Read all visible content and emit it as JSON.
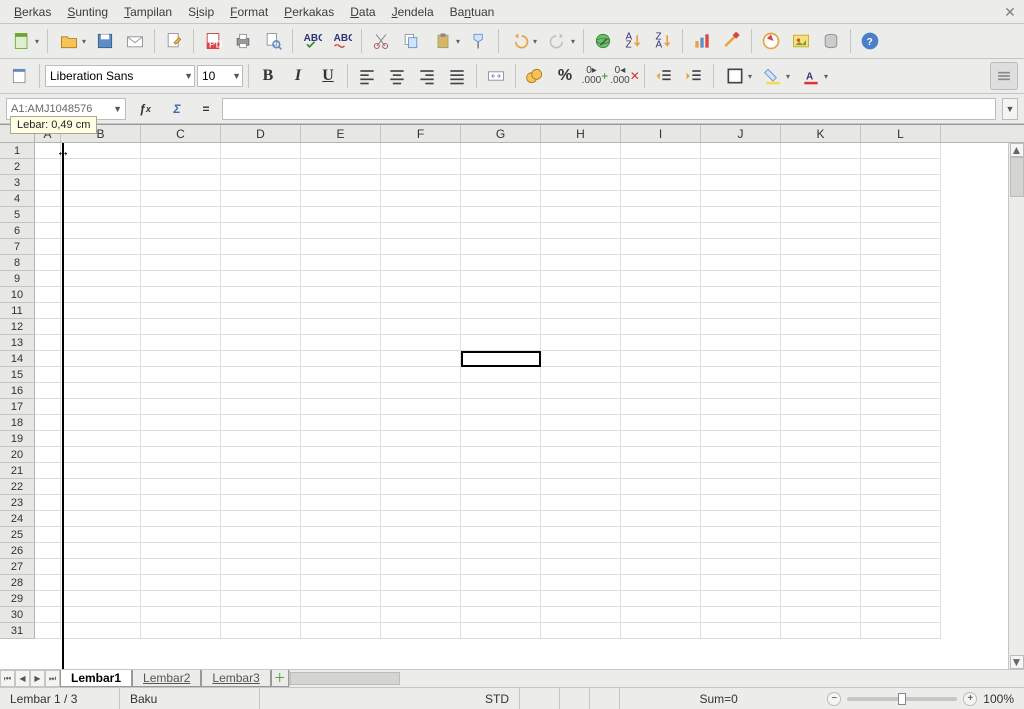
{
  "menu": {
    "items": [
      "Berkas",
      "Sunting",
      "Tampilan",
      "Sisip",
      "Format",
      "Perkakas",
      "Data",
      "Jendela",
      "Bantuan"
    ]
  },
  "toolbar1": {
    "font_name": "Liberation Sans",
    "font_size": "10"
  },
  "namebox": {
    "value": "A1:AMJ1048576"
  },
  "tooltip": {
    "text": "Lebar: 0,49 cm"
  },
  "formula": {
    "value": ""
  },
  "columns": [
    "A",
    "B",
    "C",
    "D",
    "E",
    "F",
    "G",
    "H",
    "I",
    "J",
    "K",
    "L"
  ],
  "rows": [
    1,
    2,
    3,
    4,
    5,
    6,
    7,
    8,
    9,
    10,
    11,
    12,
    13,
    14,
    15,
    16,
    17,
    18,
    19,
    20,
    21,
    22,
    23,
    24,
    25,
    26,
    27,
    28,
    29,
    30,
    31
  ],
  "selection": {
    "row": 14,
    "col_label": "G"
  },
  "tabs": {
    "active": "Lembar1",
    "others": [
      "Lembar2",
      "Lembar3"
    ]
  },
  "status": {
    "sheet": "Lembar 1 / 3",
    "style": "Baku",
    "mode": "STD",
    "sum": "Sum=0",
    "zoom": "100%"
  }
}
